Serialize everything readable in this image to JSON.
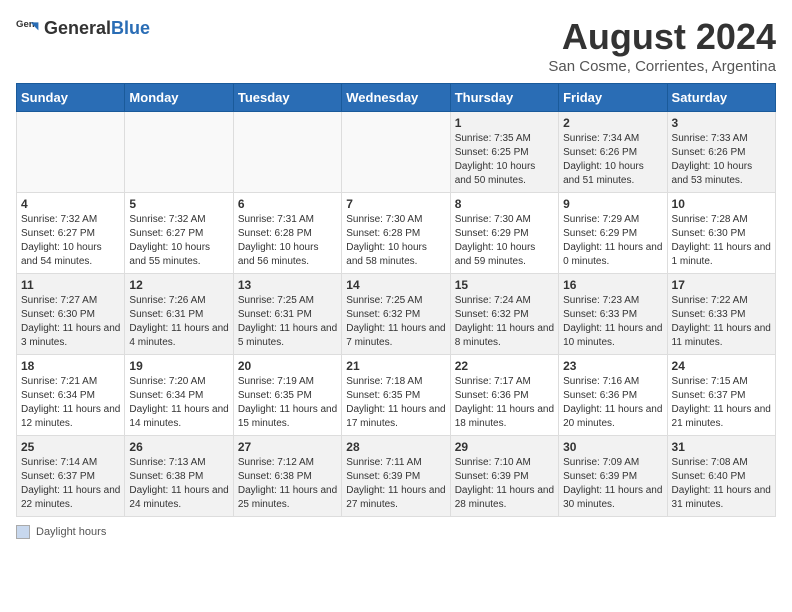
{
  "header": {
    "logo_general": "General",
    "logo_blue": "Blue",
    "main_title": "August 2024",
    "subtitle": "San Cosme, Corrientes, Argentina"
  },
  "days_of_week": [
    "Sunday",
    "Monday",
    "Tuesday",
    "Wednesday",
    "Thursday",
    "Friday",
    "Saturday"
  ],
  "weeks": [
    {
      "cells": [
        {
          "day": "",
          "content": ""
        },
        {
          "day": "",
          "content": ""
        },
        {
          "day": "",
          "content": ""
        },
        {
          "day": "",
          "content": ""
        },
        {
          "day": "1",
          "content": "Sunrise: 7:35 AM\nSunset: 6:25 PM\nDaylight: 10 hours\nand 50 minutes."
        },
        {
          "day": "2",
          "content": "Sunrise: 7:34 AM\nSunset: 6:26 PM\nDaylight: 10 hours\nand 51 minutes."
        },
        {
          "day": "3",
          "content": "Sunrise: 7:33 AM\nSunset: 6:26 PM\nDaylight: 10 hours\nand 53 minutes."
        }
      ]
    },
    {
      "cells": [
        {
          "day": "4",
          "content": "Sunrise: 7:32 AM\nSunset: 6:27 PM\nDaylight: 10 hours\nand 54 minutes."
        },
        {
          "day": "5",
          "content": "Sunrise: 7:32 AM\nSunset: 6:27 PM\nDaylight: 10 hours\nand 55 minutes."
        },
        {
          "day": "6",
          "content": "Sunrise: 7:31 AM\nSunset: 6:28 PM\nDaylight: 10 hours\nand 56 minutes."
        },
        {
          "day": "7",
          "content": "Sunrise: 7:30 AM\nSunset: 6:28 PM\nDaylight: 10 hours\nand 58 minutes."
        },
        {
          "day": "8",
          "content": "Sunrise: 7:30 AM\nSunset: 6:29 PM\nDaylight: 10 hours\nand 59 minutes."
        },
        {
          "day": "9",
          "content": "Sunrise: 7:29 AM\nSunset: 6:29 PM\nDaylight: 11 hours\nand 0 minutes."
        },
        {
          "day": "10",
          "content": "Sunrise: 7:28 AM\nSunset: 6:30 PM\nDaylight: 11 hours\nand 1 minute."
        }
      ]
    },
    {
      "cells": [
        {
          "day": "11",
          "content": "Sunrise: 7:27 AM\nSunset: 6:30 PM\nDaylight: 11 hours\nand 3 minutes."
        },
        {
          "day": "12",
          "content": "Sunrise: 7:26 AM\nSunset: 6:31 PM\nDaylight: 11 hours\nand 4 minutes."
        },
        {
          "day": "13",
          "content": "Sunrise: 7:25 AM\nSunset: 6:31 PM\nDaylight: 11 hours\nand 5 minutes."
        },
        {
          "day": "14",
          "content": "Sunrise: 7:25 AM\nSunset: 6:32 PM\nDaylight: 11 hours\nand 7 minutes."
        },
        {
          "day": "15",
          "content": "Sunrise: 7:24 AM\nSunset: 6:32 PM\nDaylight: 11 hours\nand 8 minutes."
        },
        {
          "day": "16",
          "content": "Sunrise: 7:23 AM\nSunset: 6:33 PM\nDaylight: 11 hours\nand 10 minutes."
        },
        {
          "day": "17",
          "content": "Sunrise: 7:22 AM\nSunset: 6:33 PM\nDaylight: 11 hours\nand 11 minutes."
        }
      ]
    },
    {
      "cells": [
        {
          "day": "18",
          "content": "Sunrise: 7:21 AM\nSunset: 6:34 PM\nDaylight: 11 hours\nand 12 minutes."
        },
        {
          "day": "19",
          "content": "Sunrise: 7:20 AM\nSunset: 6:34 PM\nDaylight: 11 hours\nand 14 minutes."
        },
        {
          "day": "20",
          "content": "Sunrise: 7:19 AM\nSunset: 6:35 PM\nDaylight: 11 hours\nand 15 minutes."
        },
        {
          "day": "21",
          "content": "Sunrise: 7:18 AM\nSunset: 6:35 PM\nDaylight: 11 hours\nand 17 minutes."
        },
        {
          "day": "22",
          "content": "Sunrise: 7:17 AM\nSunset: 6:36 PM\nDaylight: 11 hours\nand 18 minutes."
        },
        {
          "day": "23",
          "content": "Sunrise: 7:16 AM\nSunset: 6:36 PM\nDaylight: 11 hours\nand 20 minutes."
        },
        {
          "day": "24",
          "content": "Sunrise: 7:15 AM\nSunset: 6:37 PM\nDaylight: 11 hours\nand 21 minutes."
        }
      ]
    },
    {
      "cells": [
        {
          "day": "25",
          "content": "Sunrise: 7:14 AM\nSunset: 6:37 PM\nDaylight: 11 hours\nand 22 minutes."
        },
        {
          "day": "26",
          "content": "Sunrise: 7:13 AM\nSunset: 6:38 PM\nDaylight: 11 hours\nand 24 minutes."
        },
        {
          "day": "27",
          "content": "Sunrise: 7:12 AM\nSunset: 6:38 PM\nDaylight: 11 hours\nand 25 minutes."
        },
        {
          "day": "28",
          "content": "Sunrise: 7:11 AM\nSunset: 6:39 PM\nDaylight: 11 hours\nand 27 minutes."
        },
        {
          "day": "29",
          "content": "Sunrise: 7:10 AM\nSunset: 6:39 PM\nDaylight: 11 hours\nand 28 minutes."
        },
        {
          "day": "30",
          "content": "Sunrise: 7:09 AM\nSunset: 6:39 PM\nDaylight: 11 hours\nand 30 minutes."
        },
        {
          "day": "31",
          "content": "Sunrise: 7:08 AM\nSunset: 6:40 PM\nDaylight: 11 hours\nand 31 minutes."
        }
      ]
    }
  ],
  "legend": {
    "box_label": "Daylight hours"
  }
}
